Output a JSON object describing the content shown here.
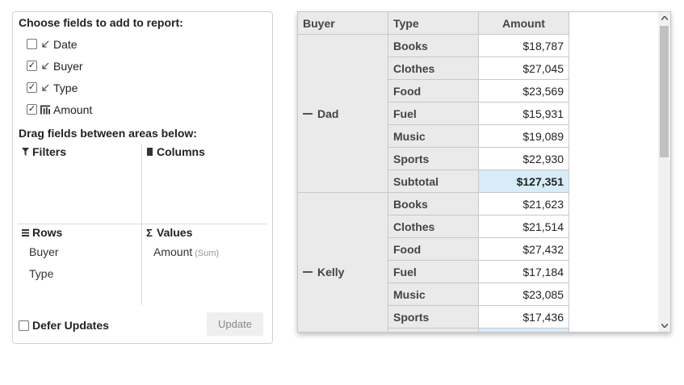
{
  "field_panel": {
    "choose_heading": "Choose fields to add to report:",
    "fields": [
      {
        "label": "Date",
        "checked": false,
        "icon": "dimension-icon"
      },
      {
        "label": "Buyer",
        "checked": true,
        "icon": "dimension-icon"
      },
      {
        "label": "Type",
        "checked": true,
        "icon": "dimension-icon"
      },
      {
        "label": "Amount",
        "checked": true,
        "icon": "measure-icon"
      }
    ],
    "drag_heading": "Drag fields between areas below:",
    "areas": {
      "filters": {
        "label": "Filters",
        "icon": "filter-icon",
        "items": []
      },
      "columns": {
        "label": "Columns",
        "icon": "columns-icon",
        "items": []
      },
      "rows": {
        "label": "Rows",
        "icon": "rows-icon",
        "items": [
          "Buyer",
          "Type"
        ]
      },
      "values": {
        "label": "Values",
        "icon": "sigma-icon",
        "items": [
          {
            "label": "Amount",
            "agg": "(Sum)"
          }
        ]
      }
    },
    "defer_label": "Defer Updates",
    "defer_checked": false,
    "update_label": "Update"
  },
  "grid": {
    "headers": {
      "buyer": "Buyer",
      "type": "Type",
      "amount": "Amount"
    },
    "groups": [
      {
        "buyer": "Dad",
        "rows": [
          {
            "type": "Books",
            "amount": "$18,787"
          },
          {
            "type": "Clothes",
            "amount": "$27,045"
          },
          {
            "type": "Food",
            "amount": "$23,569"
          },
          {
            "type": "Fuel",
            "amount": "$15,931"
          },
          {
            "type": "Music",
            "amount": "$19,089"
          },
          {
            "type": "Sports",
            "amount": "$22,930"
          },
          {
            "type": "Subtotal",
            "amount": "$127,351",
            "subtotal": true
          }
        ]
      },
      {
        "buyer": "Kelly",
        "rows": [
          {
            "type": "Books",
            "amount": "$21,623"
          },
          {
            "type": "Clothes",
            "amount": "$21,514"
          },
          {
            "type": "Food",
            "amount": "$27,432"
          },
          {
            "type": "Fuel",
            "amount": "$17,184"
          },
          {
            "type": "Music",
            "amount": "$23,085"
          },
          {
            "type": "Sports",
            "amount": "$17,436"
          },
          {
            "type": "",
            "amount": "",
            "subtotal": true
          }
        ]
      }
    ],
    "colors": {
      "header_bg": "#eaeaea",
      "subtotal_bg": "#d7ecf8",
      "border": "#c8c8c8"
    }
  }
}
